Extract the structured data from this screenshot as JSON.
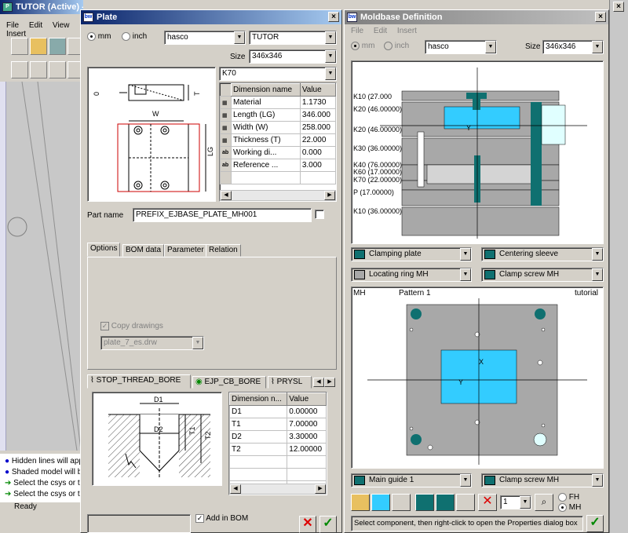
{
  "proe": {
    "title": "TUTOR (Active) - Pro/ENGINEER",
    "menu": [
      "File",
      "Edit",
      "View",
      "Insert"
    ],
    "messages": [
      "Hidden lines will app",
      "Shaded model will b",
      "Select the csys or tl",
      "Select the csys or tl"
    ],
    "ready": "Ready"
  },
  "plate": {
    "title": "Plate",
    "unit_mm": "mm",
    "unit_inch": "inch",
    "supplier": "hasco",
    "series": "TUTOR",
    "size_label": "Size",
    "size": "346x346",
    "type": "K70",
    "table_headers": [
      "Dimension name",
      "Value"
    ],
    "rows": [
      {
        "icon": "dim",
        "name": "Material",
        "value": "1.1730"
      },
      {
        "icon": "dim",
        "name": "Length (LG)",
        "value": "346.000"
      },
      {
        "icon": "dim",
        "name": "Width (W)",
        "value": "258.000"
      },
      {
        "icon": "dim",
        "name": "Thickness (T)",
        "value": "22.000"
      },
      {
        "icon": "ab",
        "name": "Working di...",
        "value": "0.000"
      },
      {
        "icon": "ab",
        "name": "Reference ...",
        "value": "3.000"
      }
    ],
    "part_name_label": "Part name",
    "part_name": "PREFIX_EJBASE_PLATE_MH001",
    "tabs": [
      "Options",
      "BOM data",
      "Parameter",
      "Relation"
    ],
    "copy_drawings": "Copy drawings",
    "drawing": "plate_7_es.drw",
    "bore_tabs": [
      "STOP_THREAD_BORE",
      "EJP_CB_BORE",
      "PRYSL"
    ],
    "bore_headers": [
      "Dimension n...",
      "Value"
    ],
    "bore_rows": [
      {
        "name": "D1",
        "value": "0.00000"
      },
      {
        "name": "T1",
        "value": "7.00000"
      },
      {
        "name": "D2",
        "value": "3.30000"
      },
      {
        "name": "T2",
        "value": "12.00000"
      }
    ],
    "add_in_bom": "Add in BOM",
    "drawing_labels": {
      "W": "W",
      "LG": "LG",
      "T": "T",
      "zero": "0",
      "D1": "D1",
      "D2": "D2",
      "T1": "T1",
      "T2": "T2"
    }
  },
  "moldbase": {
    "title": "Moldbase Definition",
    "menu": [
      "File",
      "Edit",
      "Insert"
    ],
    "unit_mm": "mm",
    "unit_inch": "inch",
    "supplier": "hasco",
    "size_label": "Size",
    "size": "346x346",
    "plate_labels": [
      "K10 (27.000",
      "K20 (46.00000)",
      "K20 (46.00000)",
      "K30 (36.00000)",
      "K40 (76.00000)",
      "K60 (17.00000)",
      "K70 (22.00000)",
      "P (17.00000)",
      "K10 (36.00000)"
    ],
    "section_y": "Y",
    "components": [
      "Clamping plate",
      "Centering sleeve",
      "Locating ring MH",
      "Clamp screw MH"
    ],
    "top_view": {
      "left": "MH",
      "center": "Pattern 1",
      "right": "tutorial",
      "x": "X",
      "y": "Y"
    },
    "bottom_components": [
      "Main guide 1",
      "Clamp screw MH"
    ],
    "spin_value": "1",
    "side_label": "FH",
    "side_mh": "MH",
    "status": "Select component, then right-click to open the Properties dialog box"
  },
  "colors": {
    "titlebar": "#0a246a",
    "cyan": "#33ccff",
    "teal": "#0f7070",
    "gray": "#a8a8a8"
  }
}
